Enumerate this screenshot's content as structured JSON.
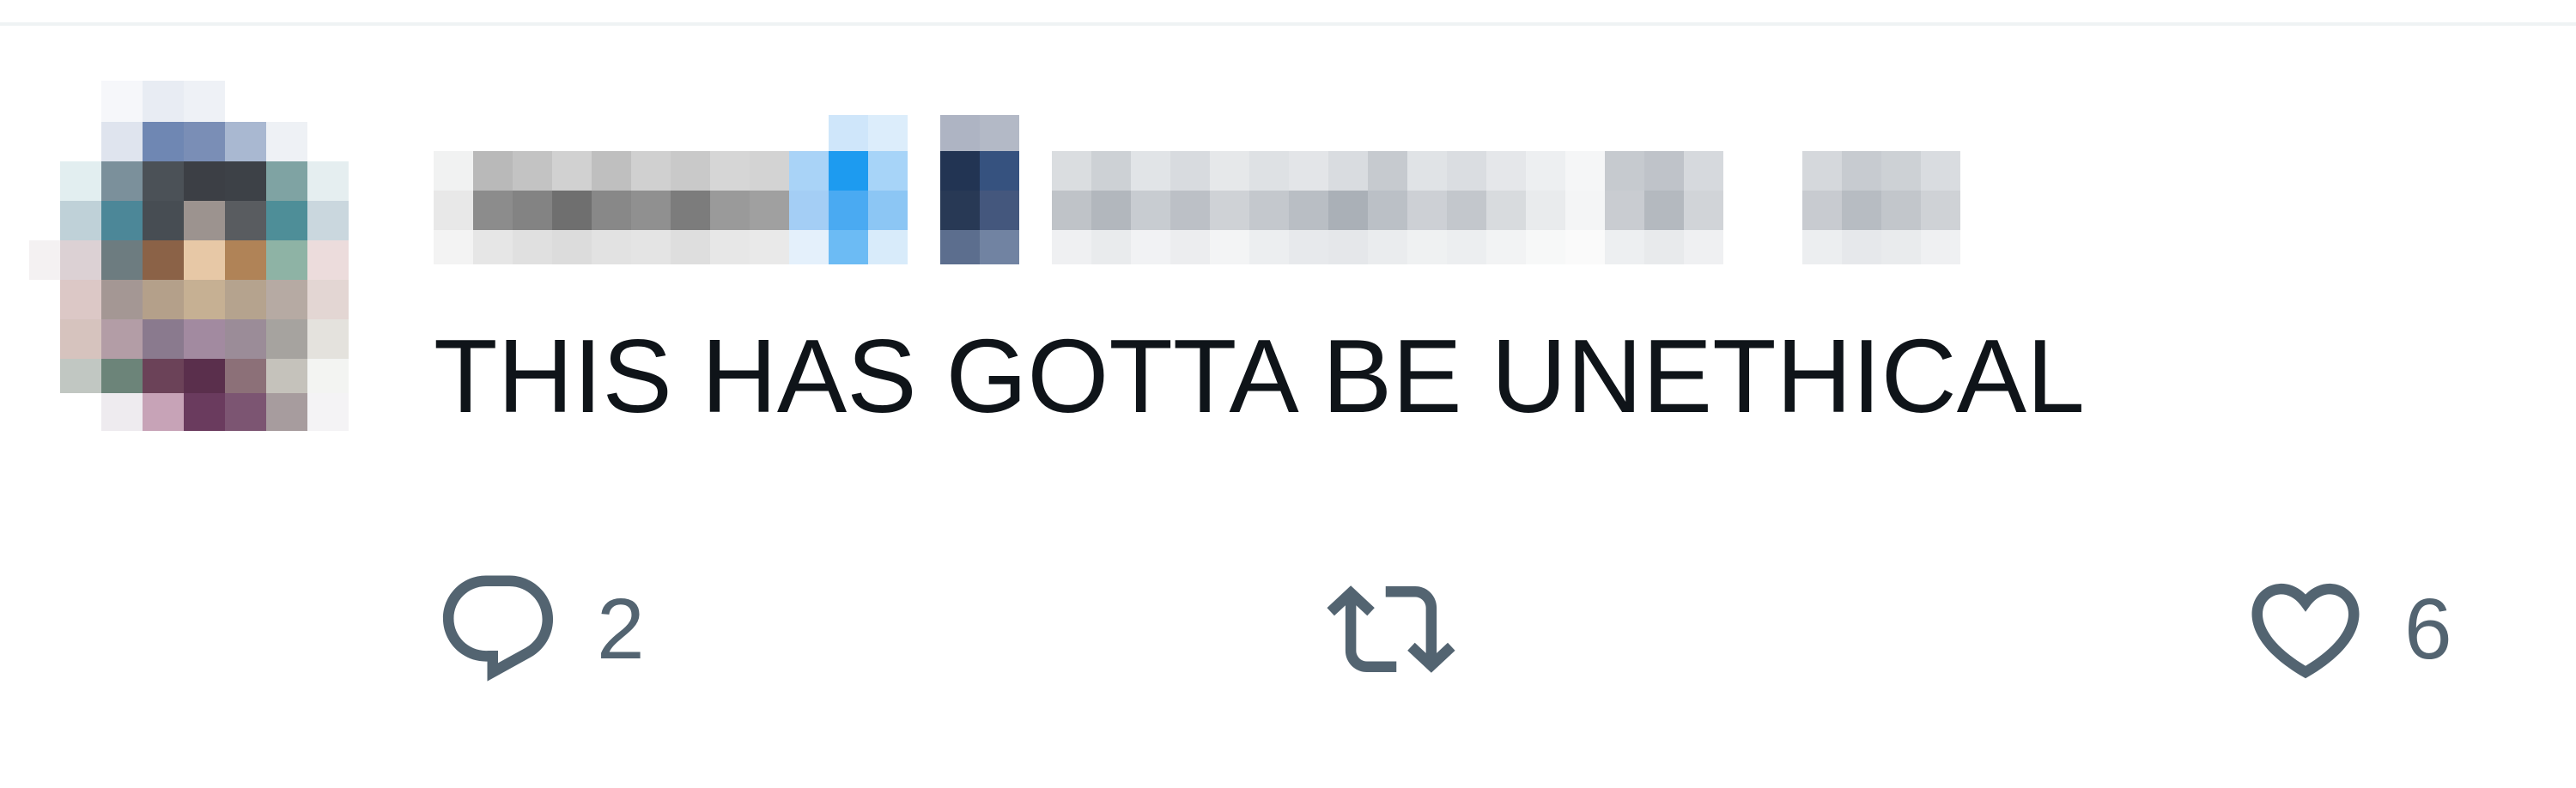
{
  "tweet": {
    "text": "THIS HAS GOTTA BE UNETHICAL",
    "author": {
      "avatar_icon": "pixelated-avatar",
      "name_icon": "pixelated-display-name",
      "handle_icon": "pixelated-handle"
    }
  },
  "actions": {
    "reply": {
      "icon": "reply-bubble-icon",
      "count": "2"
    },
    "retweet": {
      "icon": "retweet-icon",
      "count": ""
    },
    "like": {
      "icon": "heart-icon",
      "count": "6"
    }
  },
  "colors": {
    "text": "#0f1419",
    "secondary": "#536471",
    "divider": "#eff3f4",
    "verified_blue": "#1d9bf0"
  }
}
